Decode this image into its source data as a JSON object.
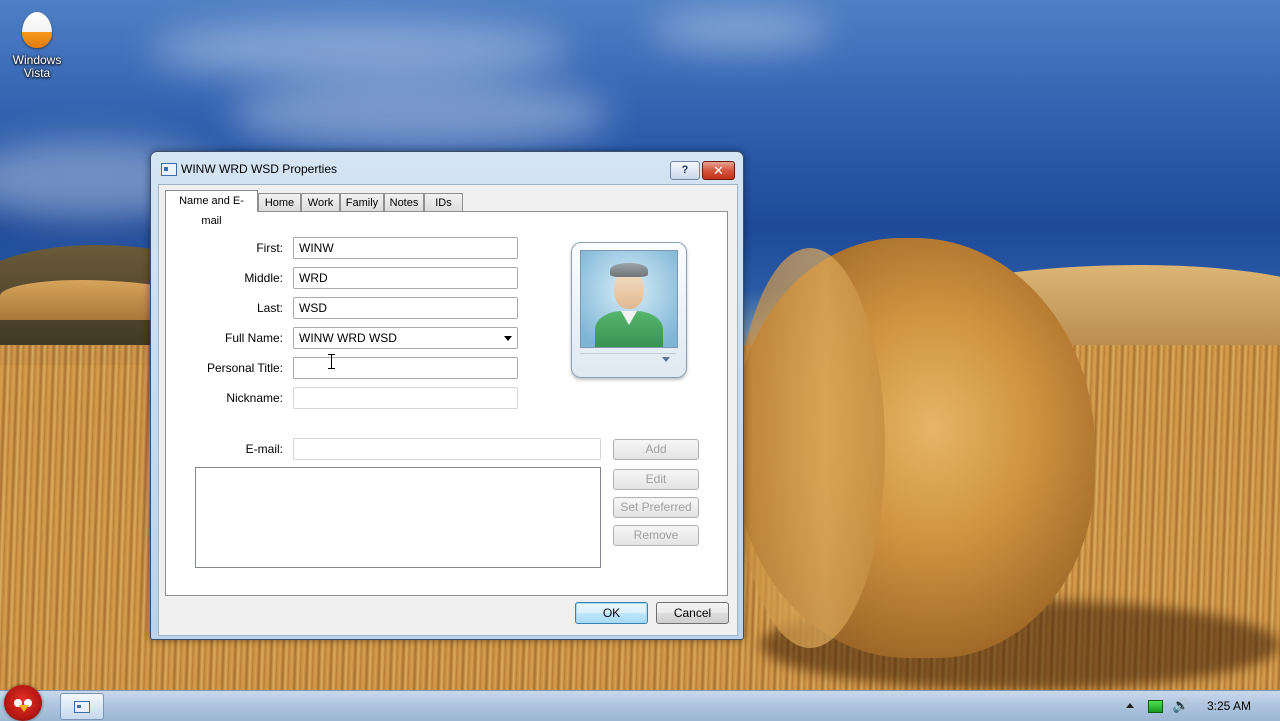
{
  "desktop": {
    "icon_label": "Windows Vista"
  },
  "window": {
    "title": "WINW WRD WSD Properties",
    "help_label": "?",
    "close_label": "✕"
  },
  "tabs": [
    {
      "label": "Name and E-mail",
      "active": true
    },
    {
      "label": "Home"
    },
    {
      "label": "Work"
    },
    {
      "label": "Family"
    },
    {
      "label": "Notes"
    },
    {
      "label": "IDs"
    }
  ],
  "form": {
    "first_label": "First:",
    "first_value": "WINW",
    "middle_label": "Middle:",
    "middle_value": "WRD",
    "last_label": "Last:",
    "last_value": "WSD",
    "fullname_label": "Full Name:",
    "fullname_value": "WINW WRD WSD",
    "personal_title_label": "Personal Title:",
    "personal_title_value": "",
    "nickname_label": "Nickname:",
    "nickname_value": "",
    "email_label": "E-mail:",
    "email_value": ""
  },
  "email_buttons": {
    "add": "Add",
    "edit": "Edit",
    "set_preferred": "Set Preferred",
    "remove": "Remove"
  },
  "footer": {
    "ok": "OK",
    "cancel": "Cancel"
  },
  "taskbar": {
    "clock": "3:25 AM"
  },
  "colors": {
    "accent": "#3c7fb1",
    "close_button": "#c33218"
  }
}
